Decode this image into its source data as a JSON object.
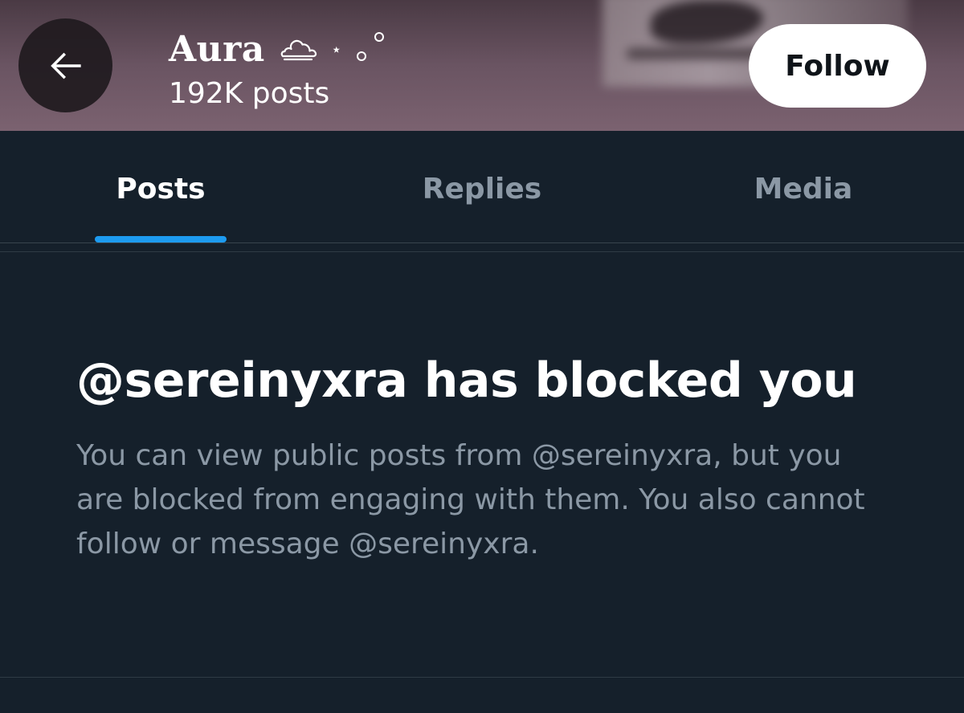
{
  "header": {
    "display_name": "Aura",
    "post_count": "192K posts",
    "follow_label": "Follow",
    "decor_star": "⋆",
    "icons": [
      "back-arrow-icon",
      "cloud-icon",
      "star-icon",
      "circles-icon"
    ]
  },
  "tabs": [
    {
      "label": "Posts",
      "active": true
    },
    {
      "label": "Replies",
      "active": false
    },
    {
      "label": "Media",
      "active": false
    }
  ],
  "notice": {
    "title": "@sereinyxra has blocked you",
    "body": "You can view public posts from @sereinyxra, but you are blocked from engaging with them. You also cannot follow or message @sereinyxra."
  },
  "colors": {
    "background": "#15202b",
    "accent": "#1d9bf0",
    "secondary_text": "#8b98a5",
    "follow_button": "#ffffff"
  }
}
